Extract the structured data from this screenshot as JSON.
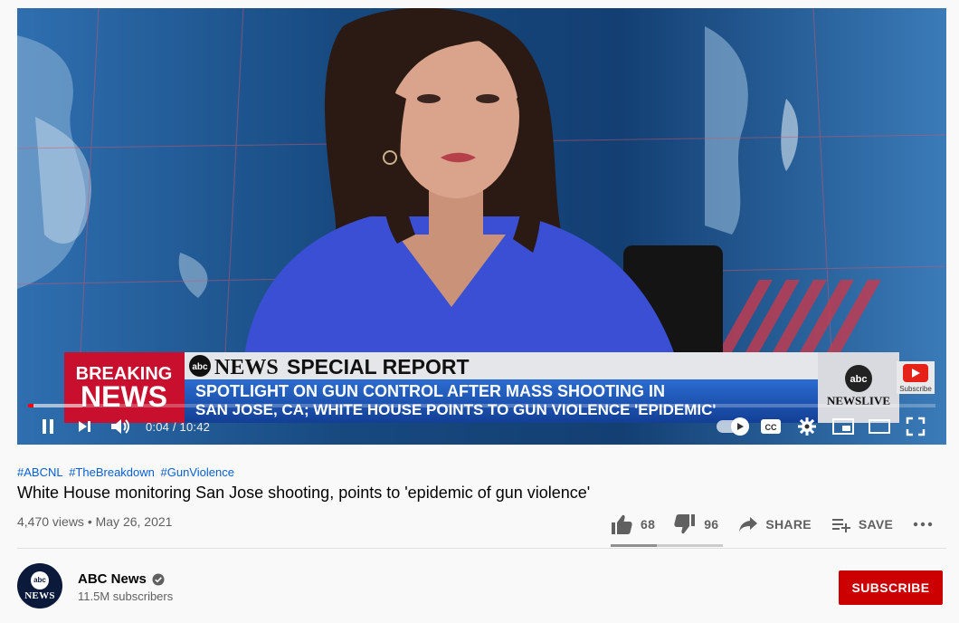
{
  "video": {
    "lower_third": {
      "breaking": "BREAKING",
      "news": "NEWS",
      "abc_logo": "abc",
      "brand": "NEWS",
      "program": "SPECIAL REPORT",
      "headline_line1": "SPOTLIGHT ON GUN CONTROL AFTER MASS SHOOTING IN",
      "headline_line2": "SAN JOSE, CA; WHITE HOUSE POINTS TO GUN VIOLENCE 'EPIDEMIC'",
      "live_logo": "abc",
      "live_label": "NEWSLIVE",
      "subscribe_overlay": "Subscribe"
    },
    "progress": 0.0064,
    "loaded": 0.06,
    "time": "0:04 / 10:42",
    "icons": [
      "pause-icon",
      "next-icon",
      "volume-icon",
      "autoplay-toggle",
      "captions-icon",
      "settings-icon",
      "miniplayer-icon",
      "theater-icon",
      "fullscreen-icon"
    ],
    "captions_label": "CC"
  },
  "hashtags": [
    "#ABCNL",
    "#TheBreakdown",
    "#GunViolence"
  ],
  "title": "White House monitoring San Jose shooting, points to 'epidemic of gun violence'",
  "meta": "4,470 views • May 26, 2021",
  "actions": {
    "likes": "68",
    "dislikes": "96",
    "share": "SHARE",
    "save": "SAVE"
  },
  "sentiment_like_ratio": 0.41,
  "channel": {
    "avatar_logo": "abc",
    "avatar_label": "NEWS",
    "name": "ABC News",
    "subscribers": "11.5M subscribers",
    "subscribe_label": "SUBSCRIBE"
  },
  "colors": {
    "accent": "#cc0000",
    "hashtag": "#065fd4",
    "breaking_red": "#c8102e",
    "headline_blue": "#1a4aa8"
  }
}
